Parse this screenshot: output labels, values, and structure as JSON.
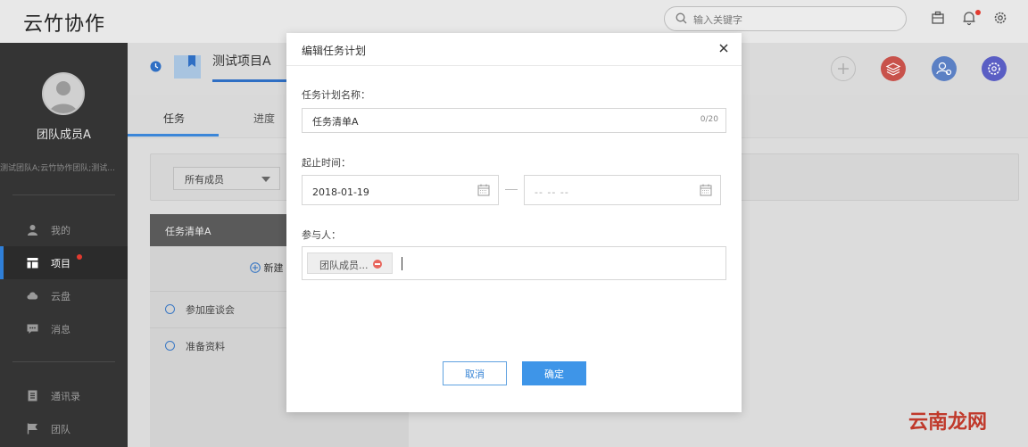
{
  "app": {
    "title": "云竹协作"
  },
  "search": {
    "placeholder": "输入关键字"
  },
  "user": {
    "name": "团队成员A",
    "teams": "测试团队A;云竹协作团队;测试..."
  },
  "sidebar": {
    "items": [
      {
        "label": "我的",
        "icon": "person-icon"
      },
      {
        "label": "项目",
        "icon": "project-icon",
        "active": true,
        "badge_dot": true
      },
      {
        "label": "云盘",
        "icon": "cloud-icon"
      },
      {
        "label": "消息",
        "icon": "message-icon"
      },
      {
        "label": "通讯录",
        "icon": "contacts-icon"
      },
      {
        "label": "团队",
        "icon": "flag-icon"
      }
    ]
  },
  "project": {
    "name": "测试项目A"
  },
  "tabs": [
    {
      "label": "任务"
    },
    {
      "label": "进度"
    }
  ],
  "filter": {
    "member_select": "所有成员"
  },
  "task_list": {
    "title": "任务清单A",
    "new_task_label": "新建",
    "items": [
      {
        "label": "参加座谈会"
      },
      {
        "label": "准备资料"
      }
    ]
  },
  "modal": {
    "title": "编辑任务计划",
    "name_label": "任务计划名称：",
    "name_value": "任务清单A",
    "name_count": "0/20",
    "date_label": "起止时间：",
    "start_date": "2018-01-19",
    "end_placeholder": "-- -- --",
    "participants_label": "参与人：",
    "participant_chip": "团队成员...",
    "cancel_label": "取消",
    "ok_label": "确定"
  },
  "watermark": {
    "text": "云南龙网"
  },
  "colors": {
    "accent": "#3e95e8",
    "sidebar_bg": "#343434",
    "badge": "#e23a2f"
  }
}
